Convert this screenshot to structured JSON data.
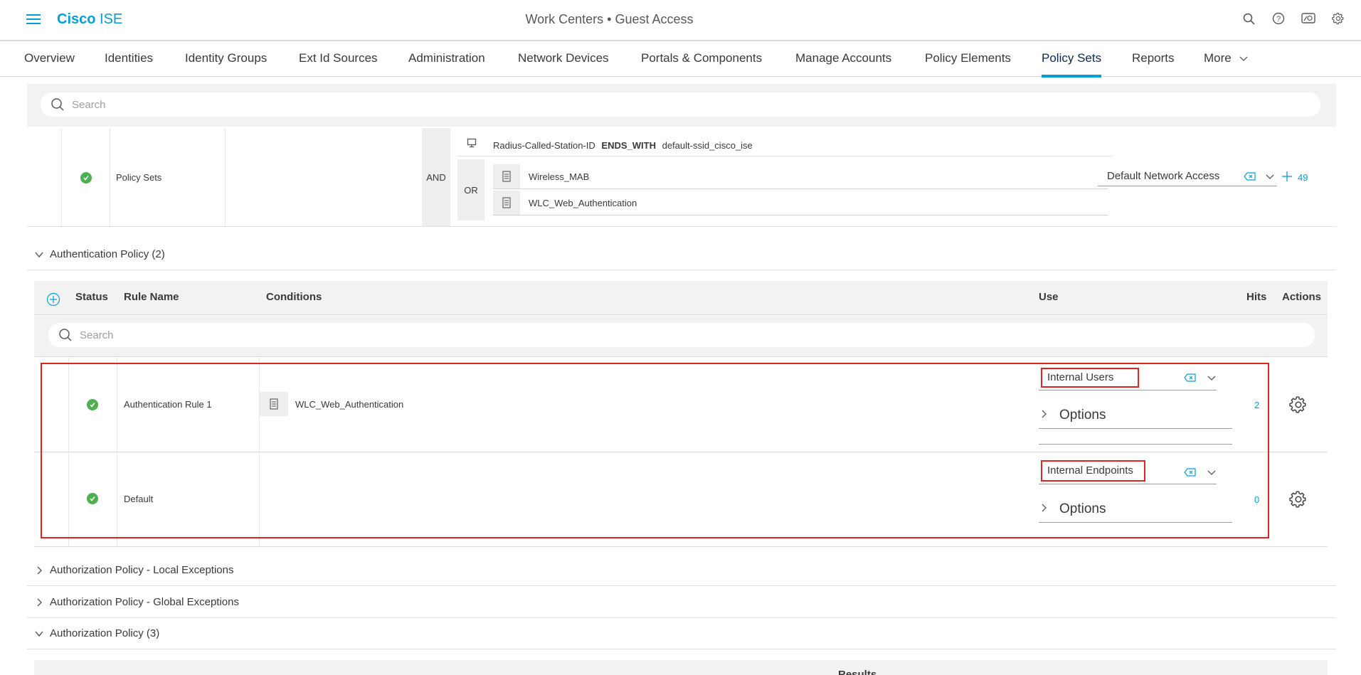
{
  "header": {
    "brand_bold": "Cisco",
    "brand_light": "ISE",
    "title": "Work Centers • Guest Access",
    "icons": [
      "search-icon",
      "help-icon",
      "dashboard-icon",
      "settings-icon"
    ]
  },
  "tabs": [
    {
      "label": "Overview"
    },
    {
      "label": "Identities"
    },
    {
      "label": "Identity Groups"
    },
    {
      "label": "Ext Id Sources"
    },
    {
      "label": "Administration"
    },
    {
      "label": "Network Devices"
    },
    {
      "label": "Portals & Components"
    },
    {
      "label": "Manage Accounts"
    },
    {
      "label": "Policy Elements"
    },
    {
      "label": "Policy Sets",
      "active": true
    },
    {
      "label": "Reports"
    },
    {
      "label": "More"
    }
  ],
  "policy_set_search": {
    "placeholder": "Search"
  },
  "policy_set": {
    "name": "Policy Sets",
    "and_label": "AND",
    "or_label": "OR",
    "condition_attr": "Radius-Called-Station-ID",
    "condition_op": "ENDS_WITH",
    "condition_value": "default-ssid_cisco_ise",
    "or_conditions": [
      "Wireless_MAB",
      "WLC_Web_Authentication"
    ],
    "allowed_protocols": "Default Network Access",
    "hits": "49"
  },
  "auth_section": {
    "title": "Authentication Policy (2)"
  },
  "auth_table": {
    "headers": {
      "status": "Status",
      "rule_name": "Rule Name",
      "conditions": "Conditions",
      "use": "Use",
      "hits": "Hits",
      "actions": "Actions"
    },
    "search_placeholder": "Search",
    "rows": [
      {
        "name": "Authentication Rule 1",
        "condition": "WLC_Web_Authentication",
        "use": "Internal Users",
        "options": "Options",
        "hits": "2"
      },
      {
        "name": "Default",
        "condition": "",
        "use": "Internal Endpoints",
        "options": "Options",
        "hits": "0"
      }
    ]
  },
  "sections": [
    {
      "title": "Authorization Policy - Local Exceptions"
    },
    {
      "title": "Authorization Policy - Global Exceptions"
    },
    {
      "title": "Authorization Policy (3)"
    }
  ],
  "results_label": "Results",
  "colors": {
    "accent": "#049fd9",
    "success": "#4caf50",
    "highlight": "#e3241b"
  }
}
